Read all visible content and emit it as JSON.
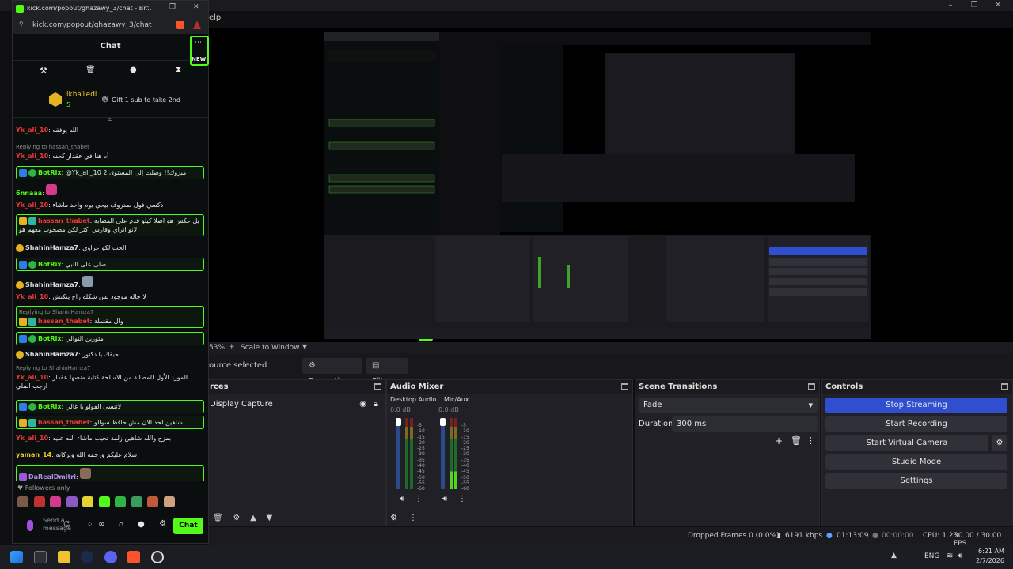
{
  "chat": {
    "window_title": "kick.com/popout/ghazawy_3/chat - Br...",
    "url": "kick.com/popout/ghazawy_3/chat",
    "header_title": "Chat",
    "new_badge": "NEW",
    "pinned_user": "ikha1edi",
    "pinned_count": "5",
    "pinned_gift_text": "Gift 1 sub to take 2nd",
    "messages": [
      {
        "user": "Yk_ali_10",
        "text": "الله يوفقه"
      },
      {
        "reply": "Replying to hassan_thabet",
        "user": "Yk_ali_10",
        "text": "أه هنا في عقدار كحنه"
      },
      {
        "user": "BotRix",
        "text": "@Yk_ali_10 ‏مبروك!! وصلت إلى المستوى 2"
      },
      {
        "user": "6nnaaa",
        "text": ""
      },
      {
        "user": "Yk_ali_10",
        "text": "دكسي فول صدروف بيحي يوم واحد ماشاء"
      },
      {
        "user": "hassan_thabet",
        "text": "بل عكس هو اصلا كيلو قدم على المصابه لانو انراي وفارس اكثر لكن مصحوب معهم هو"
      },
      {
        "user": "ShahinHamza7",
        "text": "الحب لكو عزاوي"
      },
      {
        "user": "BotRix",
        "text": "صلى على النبي"
      },
      {
        "user": "ShahinHamza7",
        "text": ""
      },
      {
        "user": "Yk_ali_10",
        "text": "لا جاله موجود بس شكله راح ينكتش"
      },
      {
        "reply": "Replying to ShahinHamza7",
        "user": "hassan_thabet",
        "text": "وال مقتملة"
      },
      {
        "user": "BotRix",
        "text": "متورين النوالي"
      },
      {
        "user": "ShahinHamza7",
        "text": "حبقك يا دكتور"
      },
      {
        "reply": "Replying to ShahinHamza7",
        "user": "Yk_ali_10",
        "text": "المورد الأول للمصابة من الاسلحة كتابة منصها عقدار ارجب الملي"
      },
      {
        "user": "BotRix",
        "text": "لاتنسى الفولو يا غالي"
      },
      {
        "user": "hassan_thabet",
        "text": "شاهين لحد الان مش حافظ سوالو"
      },
      {
        "user": "Yk_ali_10",
        "text": "بمزح والله شاهين زلمة تحيب ماشاء الله عليه"
      },
      {
        "user": "yaman_14",
        "text": "سلام عليكم ورحمه الله وبركاته"
      },
      {
        "user": "DaRealDmitri",
        "text": ""
      }
    ],
    "followers_only": "Followers only",
    "input_placeholder": "Send a message",
    "send_label": "Chat"
  },
  "obs": {
    "menu_help": "elp",
    "zoom_label": "53%",
    "scale_label": "Scale to Window",
    "source_selected": "ource selected",
    "properties_tab": "Properties",
    "filters_tab": "Filters",
    "sources_title": "rces",
    "source_item": "Display Capture",
    "audio_title": "Audio Mixer",
    "desktop_audio": "Desktop Audio",
    "mic_aux": "Mic/Aux",
    "desktop_db": "0.0 dB",
    "mic_db": "0.0 dB",
    "meter_scale": [
      "-5",
      "-10",
      "-15",
      "-20",
      "-25",
      "-30",
      "-35",
      "-40",
      "-45",
      "-50",
      "-55",
      "-60"
    ],
    "transitions_title": "Scene Transitions",
    "transition_value": "Fade",
    "duration_label": "Duration",
    "duration_value": "300 ms",
    "controls_title": "Controls",
    "stop_streaming": "Stop Streaming",
    "start_recording": "Start Recording",
    "start_virtual_camera": "Start Virtual Camera",
    "studio_mode": "Studio Mode",
    "settings": "Settings",
    "dropped_frames": "Dropped Frames 0 (0.0%)",
    "bitrate": "6191 kbps",
    "stream_time": "01:13:09",
    "rec_time": "00:00:00",
    "cpu": "CPU: 1.2%",
    "fps": "30.00 / 30.00 FPS"
  },
  "taskbar": {
    "lang": "ENG",
    "time": "6:21 AM",
    "date": "2/7/2026"
  },
  "colors": {
    "kick_green": "#53fc18",
    "obs_primary": "#2f4fd0"
  }
}
